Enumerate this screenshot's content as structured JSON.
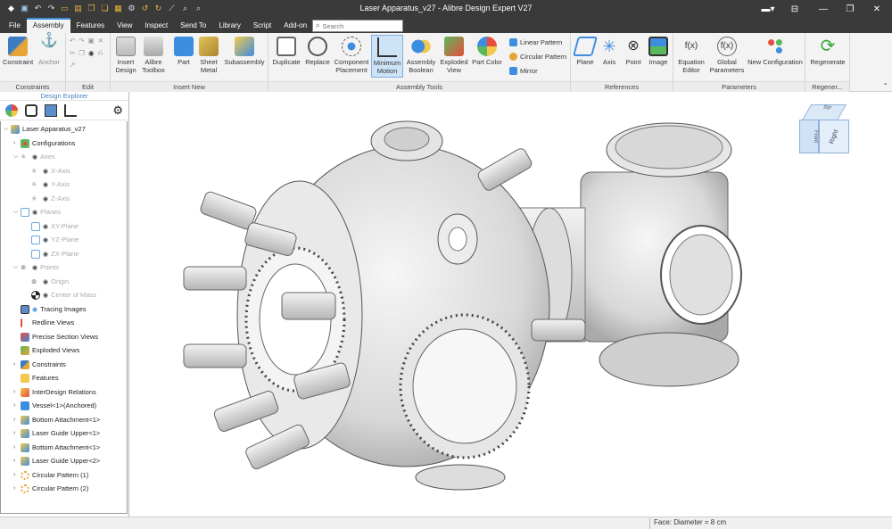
{
  "window": {
    "title": "Laser Apparatus_v27 - Alibre Design Expert V27"
  },
  "search": {
    "placeholder": "Search"
  },
  "menu": [
    {
      "label": "File"
    },
    {
      "label": "Assembly"
    },
    {
      "label": "Features"
    },
    {
      "label": "View"
    },
    {
      "label": "Inspect"
    },
    {
      "label": "Send To"
    },
    {
      "label": "Library"
    },
    {
      "label": "Script"
    },
    {
      "label": "Add-on"
    }
  ],
  "ribbon": {
    "groups": {
      "constraints": "Constraints",
      "edit": "Edit",
      "insert_new": "Insert New",
      "assembly_tools": "Assembly Tools",
      "references": "References",
      "parameters": "Parameters",
      "regenerate": "Regener..."
    },
    "buttons": {
      "constraint": "Constraint",
      "anchor": "Anchor",
      "insert_design_1": "Insert",
      "insert_design_2": "Design",
      "alibre_toolbox_1": "Alibre",
      "alibre_toolbox_2": "Toolbox",
      "part": "Part",
      "sheet_metal_1": "Sheet",
      "sheet_metal_2": "Metal",
      "subassembly": "Subassembly",
      "duplicate": "Duplicate",
      "replace": "Replace",
      "component_placement_1": "Component",
      "component_placement_2": "Placement",
      "minimum_motion_1": "Minimum",
      "minimum_motion_2": "Motion",
      "assembly_boolean_1": "Assembly",
      "assembly_boolean_2": "Boolean",
      "exploded_view_1": "Exploded",
      "exploded_view_2": "View",
      "part_color": "Part Color",
      "linear_pattern": "Linear Pattern",
      "circular_pattern": "Circular Pattern",
      "mirror": "Mirror",
      "plane": "Plane",
      "axis": "Axis",
      "point": "Point",
      "image": "Image",
      "equation_editor_1": "Equation",
      "equation_editor_2": "Editor",
      "global_parameters_1": "Global",
      "global_parameters_2": "Parameters",
      "new_configuration": "New Configuration",
      "regenerate": "Regenerate"
    }
  },
  "explorer": {
    "title": "Design Explorer",
    "items": [
      {
        "label": "Laser Apparatus_v27"
      },
      {
        "label": "Configurations"
      },
      {
        "label": "Axes"
      },
      {
        "label": "X-Axis"
      },
      {
        "label": "Y-Axis"
      },
      {
        "label": "Z-Axis"
      },
      {
        "label": "Planes"
      },
      {
        "label": "XY-Plane"
      },
      {
        "label": "YZ-Plane"
      },
      {
        "label": "ZX-Plane"
      },
      {
        "label": "Points"
      },
      {
        "label": "Origin"
      },
      {
        "label": "Center of Mass"
      },
      {
        "label": "Tracing Images"
      },
      {
        "label": "Redline Views"
      },
      {
        "label": "Precise Section Views"
      },
      {
        "label": "Exploded Views"
      },
      {
        "label": "Constraints"
      },
      {
        "label": "Features"
      },
      {
        "label": "InterDesign Relations"
      },
      {
        "label": "Vessel<1>(Anchored)"
      },
      {
        "label": "Bottom Attachment<1>"
      },
      {
        "label": "Laser Guide Upper<1>"
      },
      {
        "label": "Bottom Attachment<1>"
      },
      {
        "label": "Laser Guide Upper<2>"
      },
      {
        "label": "Circular Pattern (1)"
      },
      {
        "label": "Circular Pattern (2)"
      }
    ]
  },
  "viewcube": {
    "top": "Top",
    "front": "Front",
    "right": "Right"
  },
  "status": {
    "text": "Face: Diameter = 8 cm"
  }
}
